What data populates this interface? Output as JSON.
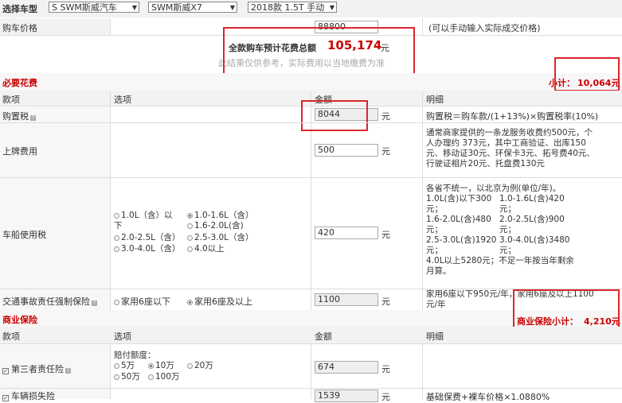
{
  "top": {
    "label": "选择车型",
    "brand_select": "S SWM斯威汽车",
    "model_select": "SWM斯威X7",
    "trim_select": "2018款 1.5T 手动"
  },
  "price": {
    "label": "购车价格",
    "value": "88800",
    "note": "(可以手动输入实际成交价格)"
  },
  "total": {
    "label": "全款购车预计花费总额",
    "amount": "105,174",
    "unit": "元",
    "disclaimer": "此结果仅供参考，实际费用以当地缴费为准"
  },
  "required": {
    "title": "必要花费",
    "subtotal_label": "小计：",
    "subtotal_value": "10,064元"
  },
  "columns": {
    "item": "款项",
    "option": "选项",
    "amount": "金额",
    "detail": "明细"
  },
  "rows": {
    "purchase_tax": {
      "label": "购置税",
      "value": "8044",
      "unit": "元",
      "detail": "购置税＝购车款/(1+13%)×购置税率(10%)"
    },
    "plate_fee": {
      "label": "上牌费用",
      "value": "500",
      "unit": "元",
      "detail_1": "通常商家提供的一条龙服务收费约500元，个",
      "detail_2": "人办理约 373元，其中工商验证、出库150",
      "detail_3": "元、移动证30元、环保卡3元、拓号费40元、",
      "detail_4": "行驶证相片20元、托盘费130元"
    },
    "vessel_tax": {
      "label": "车船使用税",
      "opt_1": "1.0L（含）以",
      "opt_1b": "下",
      "opt_2": "1.0-1.6L（含）",
      "opt_3": "1.6-2.0L(含)",
      "opt_4": "2.0-2.5L（含）",
      "opt_5": "2.5-3.0L（含）",
      "opt_6": "3.0-4.0L（含）",
      "opt_7": "4.0以上",
      "value": "420",
      "unit": "元",
      "detail_head": "各省不统一，以北京为例(单位/年)。",
      "d_l1": "1.0L(含)以下300",
      "d_r1": "1.0-1.6L(含)420",
      "d_l2": "元；",
      "d_r2": "元；",
      "d_l3": "1.6-2.0L(含)480",
      "d_r3": "2.0-2.5L(含)900",
      "d_l4": "元；",
      "d_r4": "元；",
      "d_l5": "2.5-3.0L(含)1920",
      "d_r5": "3.0-4.0L(含)3480",
      "d_l6": "元；",
      "d_r6": "元；",
      "d_tail_1": "4.0L以上5280元；不足一年按当年剩余",
      "d_tail_2": "月算。"
    },
    "compulsory": {
      "label": "交通事故责任强制保险",
      "opt_1": "家用6座以下",
      "opt_2": "家用6座及以上",
      "value": "1100",
      "unit": "元",
      "detail_1": "家用6座以下950元/年，家用6座及以上1100",
      "detail_2": "元/年"
    }
  },
  "commercial": {
    "title": "商业保险",
    "subtotal_label": "商业保险小计：",
    "subtotal_value": "4,210元"
  },
  "rows2": {
    "third_party": {
      "label": "第三者责任险",
      "quota_label": "赔付额度：",
      "opt_5": "5万",
      "opt_10": "10万",
      "opt_20": "20万",
      "opt_50": "50万",
      "opt_100": "100万",
      "value": "674",
      "unit": "元"
    },
    "vehicle_loss": {
      "label": "车辆损失险",
      "value": "1539",
      "unit": "元",
      "detail": "基础保费+裸车价格×1.0880%"
    }
  },
  "colors": {
    "accent": "#d9262c",
    "section_red": "#cc0000",
    "header_bg": "#f2f2f2"
  }
}
